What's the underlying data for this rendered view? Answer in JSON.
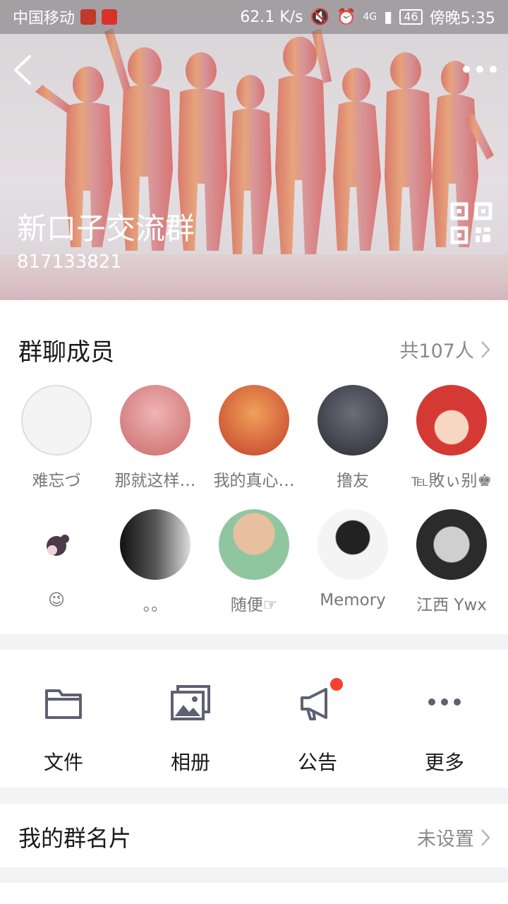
{
  "statusbar": {
    "carrier": "中国移动",
    "speed": "62.1 K/s",
    "network": "4G",
    "battery": "46",
    "time": "傍晚5:35"
  },
  "header": {
    "group_name": "新口子交流群",
    "group_id": "817133821"
  },
  "members": {
    "title": "群聊成员",
    "count_label": "共107人",
    "list": [
      {
        "name": "难忘づ",
        "color": "#f2f2f2"
      },
      {
        "name": "那就这样…",
        "color": "#f7d9d9"
      },
      {
        "name": "我的真心…",
        "color": "#e2653a"
      },
      {
        "name": "撸友",
        "color": "#3d3f46"
      },
      {
        "name": "℡敗ぃ别♚",
        "color": "#c9322d"
      },
      {
        "name": "😉",
        "color": "#ffffff"
      },
      {
        "name": "。。",
        "color": "#222222"
      },
      {
        "name": "随便☞",
        "color": "#8fc6a0"
      },
      {
        "name": "Memory",
        "color": "#f4f4f4"
      },
      {
        "name": "江西  Ywx",
        "color": "#2b2b2b"
      }
    ]
  },
  "actions": {
    "files": "文件",
    "album": "相册",
    "notice": "公告",
    "more": "更多"
  },
  "card": {
    "label": "我的群名片",
    "value": "未设置"
  },
  "colors": {
    "accent_badge": "#f5422e",
    "icon": "#5f6172"
  }
}
